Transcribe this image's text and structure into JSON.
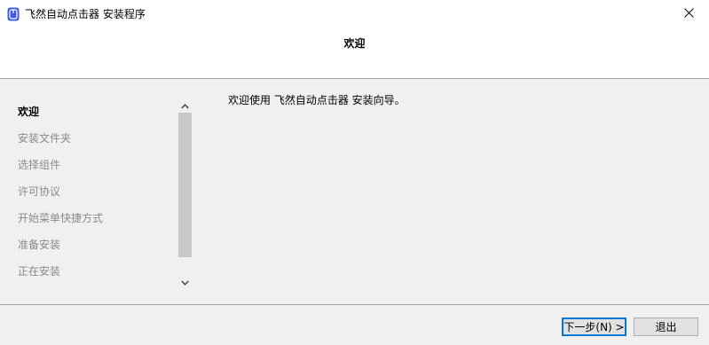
{
  "window": {
    "title": "飞然自动点击器 安装程序"
  },
  "header": {
    "title": "欢迎"
  },
  "steps": [
    {
      "label": "欢迎",
      "active": true
    },
    {
      "label": "安装文件夹",
      "active": false
    },
    {
      "label": "选择组件",
      "active": false
    },
    {
      "label": "许可协议",
      "active": false
    },
    {
      "label": "开始菜单快捷方式",
      "active": false
    },
    {
      "label": "准备安装",
      "active": false
    },
    {
      "label": "正在安装",
      "active": false
    }
  ],
  "main": {
    "welcome_text": "欢迎使用 飞然自动点击器 安装向导。"
  },
  "buttons": {
    "next": "下一步(N) >",
    "quit": "退出"
  },
  "colors": {
    "accent": "#0078d7",
    "app_icon": "#3b5bdb",
    "inactive_text": "#8a8a8a"
  }
}
